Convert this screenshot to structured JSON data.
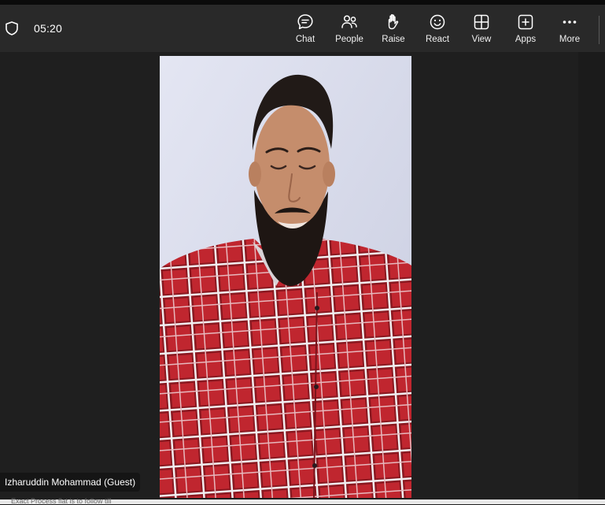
{
  "meeting": {
    "elapsed_time": "05:20",
    "participant_name": "Izharuddin Mohammad (Guest)"
  },
  "toolbar": {
    "buttons": [
      {
        "label": "Chat",
        "icon": "chat-icon"
      },
      {
        "label": "People",
        "icon": "people-icon"
      },
      {
        "label": "Raise",
        "icon": "raise-hand-icon"
      },
      {
        "label": "React",
        "icon": "smiley-icon"
      },
      {
        "label": "View",
        "icon": "grid-icon"
      },
      {
        "label": "Apps",
        "icon": "add-app-icon"
      },
      {
        "label": "More",
        "icon": "ellipsis-icon"
      }
    ]
  },
  "background_text": "Exact Process flat is to follow till"
}
